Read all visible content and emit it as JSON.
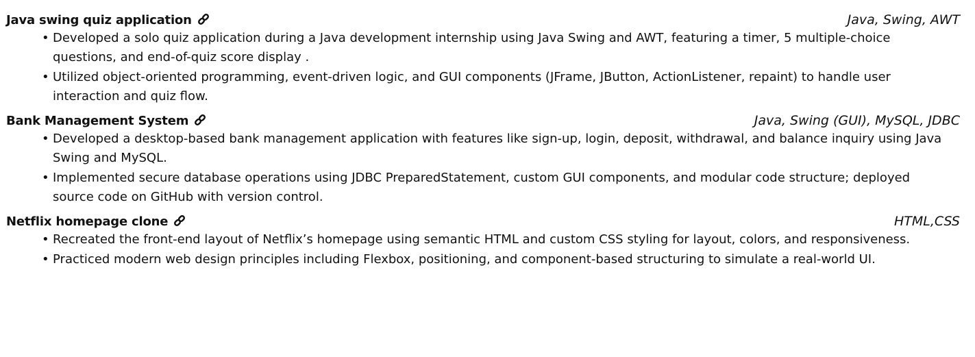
{
  "projects": [
    {
      "title": "Java swing quiz application",
      "tech": "Java, Swing, AWT",
      "bullets": [
        "Developed a solo quiz application during a Java development internship using Java Swing and AWT, featuring a timer, 5 multiple-choice questions, and end-of-quiz score display .",
        "Utilized object-oriented programming, event-driven logic, and GUI components (JFrame, JButton, ActionListener, repaint) to handle user interaction and quiz flow."
      ]
    },
    {
      "title": "Bank Management System",
      "tech": "Java, Swing (GUI), MySQL, JDBC",
      "bullets": [
        "Developed a desktop-based bank management application with features like sign-up, login, deposit, withdrawal, and balance inquiry using Java Swing and MySQL.",
        "Implemented secure database operations using JDBC PreparedStatement, custom GUI components, and modular code structure; deployed source code on GitHub with version control."
      ]
    },
    {
      "title": "Netflix homepage clone",
      "tech": "HTML,CSS",
      "bullets": [
        "Recreated the front-end layout of Netflix’s homepage using semantic HTML and custom CSS styling for layout, colors, and responsiveness.",
        "Practiced modern web design principles including Flexbox, positioning, and component-based structuring to simulate a real-world UI."
      ]
    }
  ],
  "icons": {
    "project_link": "link-icon"
  }
}
